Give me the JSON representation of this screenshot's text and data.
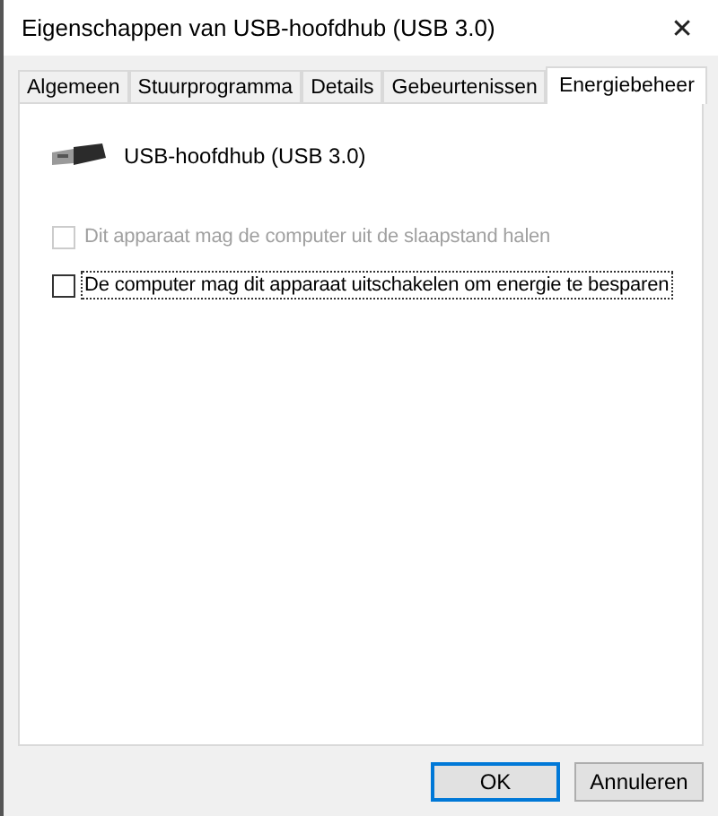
{
  "window": {
    "title": "Eigenschappen van USB-hoofdhub (USB 3.0)",
    "close": "✕"
  },
  "tabs": [
    {
      "label": "Algemeen",
      "selected": false
    },
    {
      "label": "Stuurprogramma",
      "selected": false
    },
    {
      "label": "Details",
      "selected": false
    },
    {
      "label": "Gebeurtenissen",
      "selected": false
    },
    {
      "label": "Energiebeheer",
      "selected": true
    }
  ],
  "device": {
    "name": "USB-hoofdhub (USB 3.0)"
  },
  "options": [
    {
      "label": "Dit apparaat mag de computer uit de slaapstand halen",
      "checked": false,
      "disabled": true,
      "focused": false
    },
    {
      "label": "De computer mag dit apparaat uitschakelen om energie te besparen",
      "checked": false,
      "disabled": false,
      "focused": true
    }
  ],
  "buttons": [
    {
      "label": "OK",
      "default": true
    },
    {
      "label": "Annuleren",
      "default": false
    }
  ]
}
